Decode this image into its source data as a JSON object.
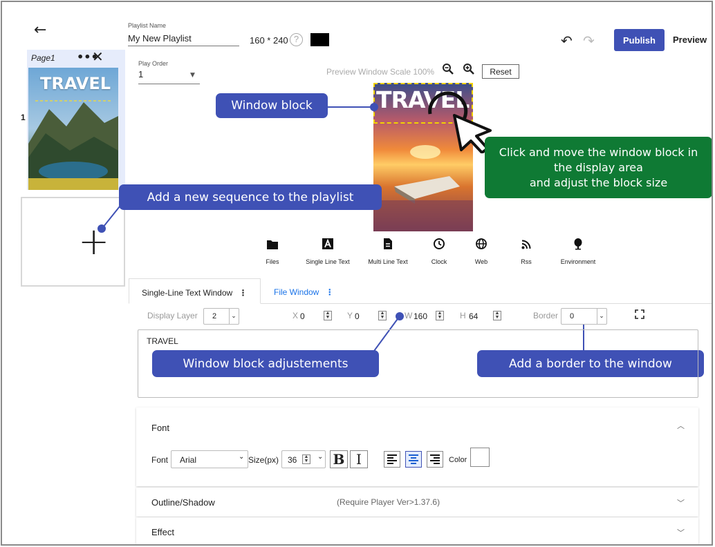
{
  "header": {
    "playlist_name_label": "Playlist Name",
    "playlist_name_value": "My New Playlist",
    "dimensions": "160 * 240",
    "help": "?",
    "publish_label": "Publish",
    "preview_label": "Preview",
    "play_order_label": "Play Order",
    "play_order_value": "1"
  },
  "sidebar": {
    "page_label": "Page1",
    "page_menu": "•••",
    "close": "✕",
    "sequence_number": "1",
    "thumbnail_title": "TRAVEL",
    "add_symbol": "+"
  },
  "preview": {
    "scale_label": "Preview Window Scale",
    "scale_value": "100%",
    "reset_label": "Reset",
    "canvas_title": "TRAVEL"
  },
  "callouts": {
    "window_block": "Window block",
    "add_sequence": "Add a new sequence to the playlist",
    "move_block": "Click and move the window block in\nthe display area\nand adjust the block size",
    "adjustments": "Window block adjustements",
    "border": "Add a border to the window"
  },
  "widgets": [
    {
      "label": "Files",
      "icon": "folder-icon"
    },
    {
      "label": "Single Line Text",
      "icon": "text-a-icon"
    },
    {
      "label": "Multi Line Text",
      "icon": "document-icon"
    },
    {
      "label": "Clock",
      "icon": "clock-icon"
    },
    {
      "label": "Web",
      "icon": "globe-icon"
    },
    {
      "label": "Rss",
      "icon": "rss-icon"
    },
    {
      "label": "Environment",
      "icon": "environment-icon"
    }
  ],
  "tabs": {
    "single_line": "Single-Line Text Window",
    "file_window": "File Window"
  },
  "properties": {
    "display_layer_label": "Display Layer",
    "display_layer_value": "2",
    "x_label": "X",
    "x_value": "0",
    "y_label": "Y",
    "y_value": "0",
    "w_label": "W",
    "w_value": "160",
    "h_label": "H",
    "h_value": "64",
    "border_label": "Border",
    "border_value": "0"
  },
  "text_content": "TRAVEL",
  "font_section": {
    "title": "Font",
    "font_label": "Font",
    "font_value": "Arial",
    "size_label": "Size(px)",
    "size_value": "36",
    "bold": "B",
    "italic": "I",
    "color_label": "Color"
  },
  "outline_section": {
    "title": "Outline/Shadow",
    "note": "(Require Player Ver>1.37.6)"
  },
  "effect_section": {
    "title": "Effect"
  },
  "colors": {
    "accent": "#3f51b5",
    "callout_green": "#0f7a34",
    "window_border": "#f2d200"
  }
}
